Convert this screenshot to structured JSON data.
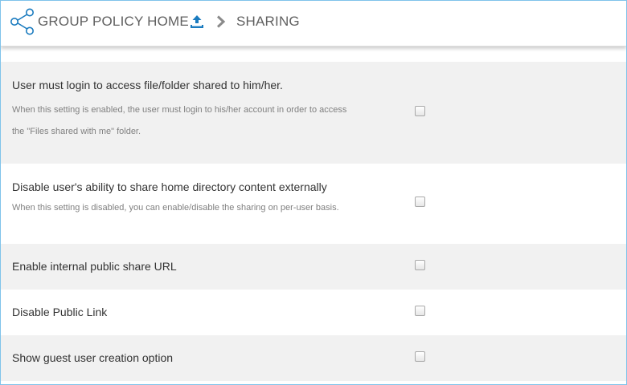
{
  "header": {
    "home_label": "GROUP POLICY HOME",
    "current_label": "SHARING",
    "icons": [
      "share-icon",
      "upload-icon",
      "chevron-right-icon"
    ],
    "accent_color": "#1a7bbf"
  },
  "settings": [
    {
      "title": "User must login to access file/folder shared to him/her.",
      "description_lines": [
        "When this setting is enabled, the user must login to his/her account in order to access",
        "the \"Files shared with me\" folder."
      ],
      "checked": false
    },
    {
      "title": "Disable user's ability to share home directory content externally",
      "description_lines": [
        "When this setting is disabled, you can enable/disable the sharing on per-user basis."
      ],
      "checked": false
    },
    {
      "title": "Enable internal public share URL",
      "checked": false
    },
    {
      "title": "Disable Public Link",
      "checked": false
    },
    {
      "title": "Show guest user creation option",
      "checked": false
    }
  ]
}
